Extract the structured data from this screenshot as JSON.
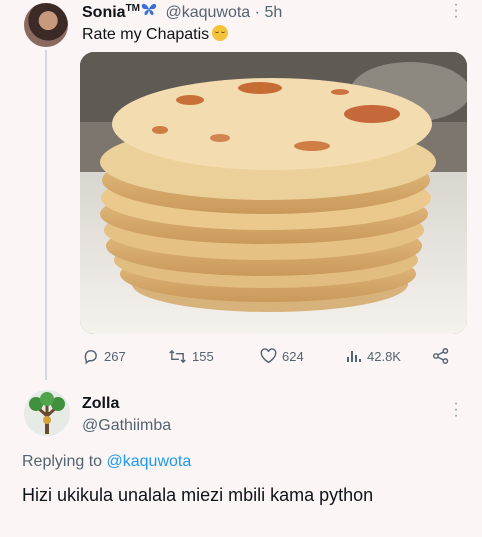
{
  "tweet": {
    "author_name": "Sonia",
    "author_mark": "TM",
    "author_emoji_icon": "butterfly-icon",
    "handle": "@kaquwota",
    "separator": "·",
    "time": "5h",
    "text": "Rate my Chapatis",
    "text_emoji_icon": "smiling-face-icon",
    "image_subject": "stack of chapatis",
    "actions": {
      "replies": "267",
      "retweets": "155",
      "likes": "624",
      "views": "42.8K"
    }
  },
  "reply": {
    "author_name": "Zolla",
    "handle": "@Gathiimba",
    "replying_to_label": "Replying to",
    "replying_to_handle": "@kaquwota",
    "text": "Hizi ukikula unalala miezi mbili kama python"
  },
  "colors": {
    "accent": "#1d9bf0",
    "muted": "#536471",
    "background": "#fbf5f5"
  }
}
